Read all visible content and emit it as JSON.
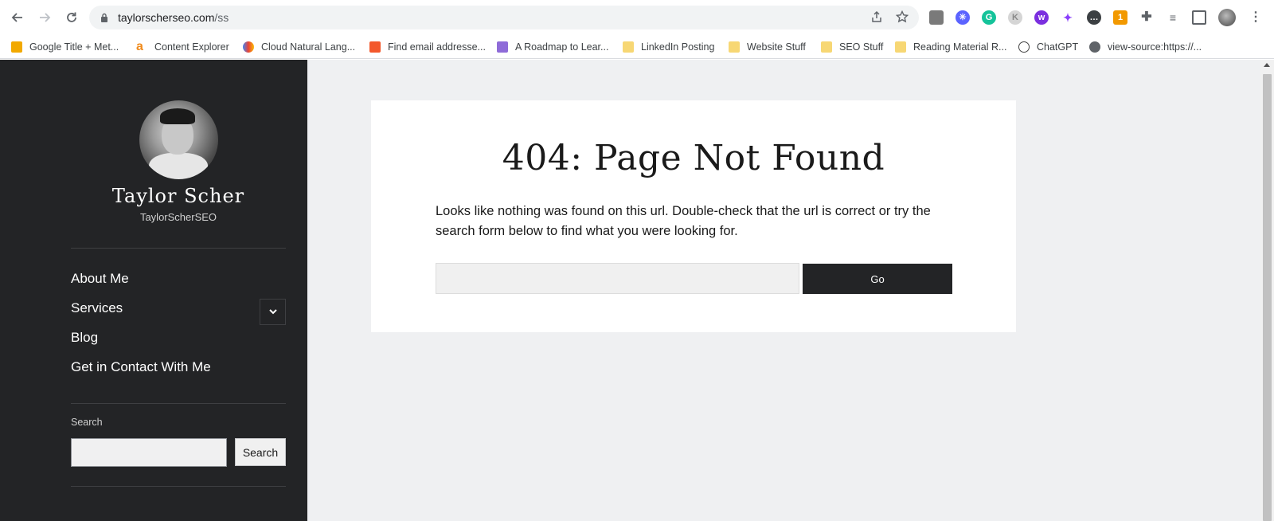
{
  "browser": {
    "url_host": "taylorscherseo.com",
    "url_path": "/ss",
    "back_icon": "arrow-left",
    "forward_icon": "arrow-right",
    "reload_icon": "reload",
    "bookmarks": [
      {
        "label": "Google Title + Met...",
        "icon": "ttm-icon",
        "color": "#f2a900"
      },
      {
        "label": "Content Explorer",
        "icon": "ahrefs-icon",
        "color": "#f08b1d"
      },
      {
        "label": "Cloud Natural Lang...",
        "icon": "google-cloud-icon",
        "color": "#4285f4"
      },
      {
        "label": "Find email addresse...",
        "icon": "hunter-icon",
        "color": "#f3582c"
      },
      {
        "label": "A Roadmap to Lear...",
        "icon": "ls-icon",
        "color": "#8e6bd8"
      },
      {
        "label": "LinkedIn Posting",
        "icon": "folder-icon",
        "color": "#f7d774"
      },
      {
        "label": "Website Stuff",
        "icon": "folder-icon",
        "color": "#f7d774"
      },
      {
        "label": "SEO Stuff",
        "icon": "folder-icon",
        "color": "#f7d774"
      },
      {
        "label": "Reading Material R...",
        "icon": "folder-icon",
        "color": "#f7d774"
      },
      {
        "label": "ChatGPT",
        "icon": "chatgpt-icon",
        "color": "#444444"
      },
      {
        "label": "view-source:https://...",
        "icon": "globe-icon",
        "color": "#5f6368"
      }
    ],
    "extension_badge": "1"
  },
  "sidebar": {
    "title": "Taylor Scher",
    "subtitle": "TaylorScherSEO",
    "menu": [
      {
        "label": "About Me"
      },
      {
        "label": "Services",
        "has_submenu": true
      },
      {
        "label": "Blog"
      },
      {
        "label": "Get in Contact With Me"
      }
    ],
    "search_label": "Search",
    "search_button": "Search",
    "search_value": ""
  },
  "main": {
    "heading": "404: Page Not Found",
    "message": "Looks like nothing was found on this url. Double-check that the url is correct or try the search form below to find what you were looking for.",
    "search_value": "",
    "go_button": "Go"
  },
  "colors": {
    "sidebar_bg": "#232426",
    "content_bg": "#eff0f2",
    "button_dark": "#232426"
  }
}
